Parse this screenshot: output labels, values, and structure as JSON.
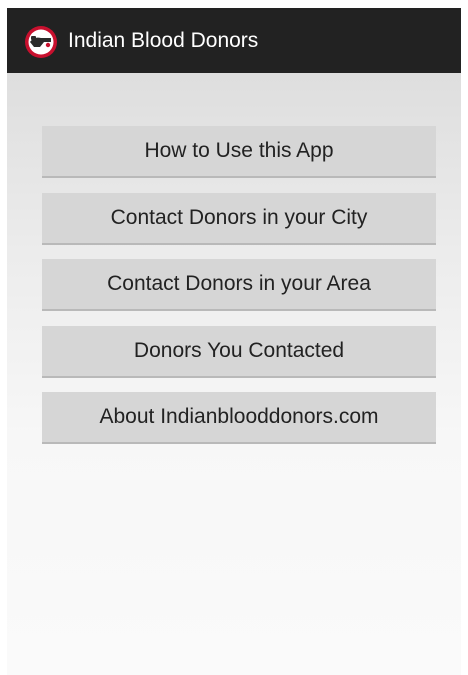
{
  "action_bar": {
    "title": "Indian Blood Donors",
    "icon": "app-logo-icon",
    "background": "#222222"
  },
  "menu": {
    "buttons": [
      {
        "label": "How to Use this App"
      },
      {
        "label": "Contact Donors in your City"
      },
      {
        "label": "Contact Donors in your Area"
      },
      {
        "label": "Donors You Contacted"
      },
      {
        "label": "About Indianblooddonors.com"
      }
    ]
  }
}
